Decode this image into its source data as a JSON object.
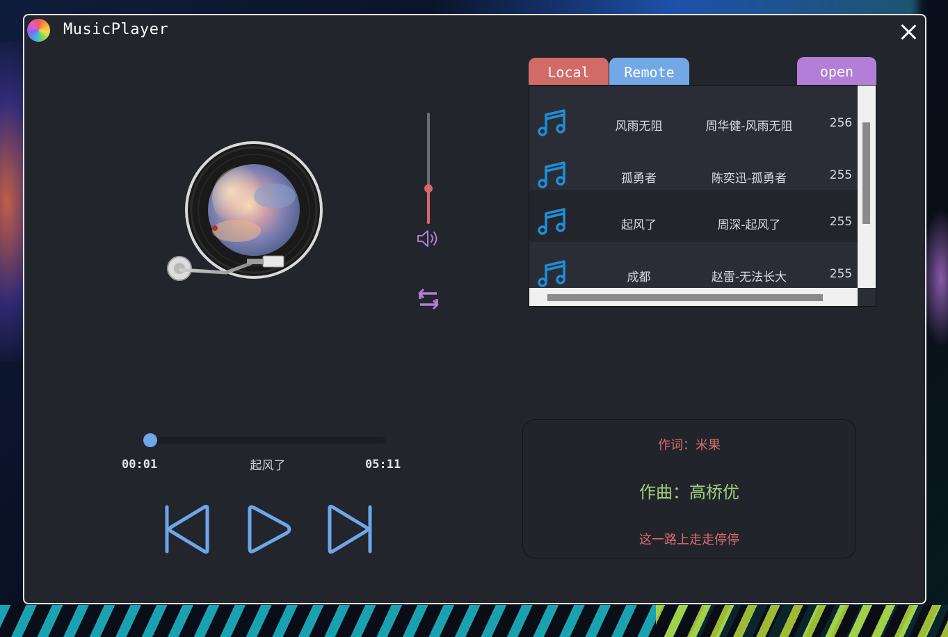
{
  "window": {
    "title": "MusicPlayer"
  },
  "tabs": {
    "local": "Local",
    "remote": "Remote",
    "open": "open"
  },
  "playlist": {
    "rows": [
      {
        "title": "风雨无阻",
        "artist": "周华健-风雨无阻",
        "num": "256"
      },
      {
        "title": "孤勇者",
        "artist": "陈奕迅-孤勇者",
        "num": "255"
      },
      {
        "title": "起风了",
        "artist": "周深-起风了",
        "num": "255"
      },
      {
        "title": "成都",
        "artist": "赵雷-无法长大",
        "num": "255"
      }
    ],
    "selected_index": 2,
    "vscroll_position": 0.36,
    "vscroll_visible_fraction": 0.5
  },
  "player": {
    "current_time": "00:01",
    "total_time": "05:11",
    "now_playing": "起风了",
    "progress": 0.003,
    "volume": 0.32,
    "repeat_icon": "repeat-icon",
    "volume_icon": "speaker-icon"
  },
  "lyrics": {
    "line1": "作词：米果",
    "line2": "作曲：高桥优",
    "line3": "这一路上走走停停"
  },
  "colors": {
    "background": "#23252c",
    "local_tab": "#d16b68",
    "remote_tab": "#72a8e6",
    "open_button": "#b27ed7",
    "accent_blue": "#6ea6ea",
    "accent_red": "#d86969",
    "lyric_highlight": "#9fd07d"
  }
}
